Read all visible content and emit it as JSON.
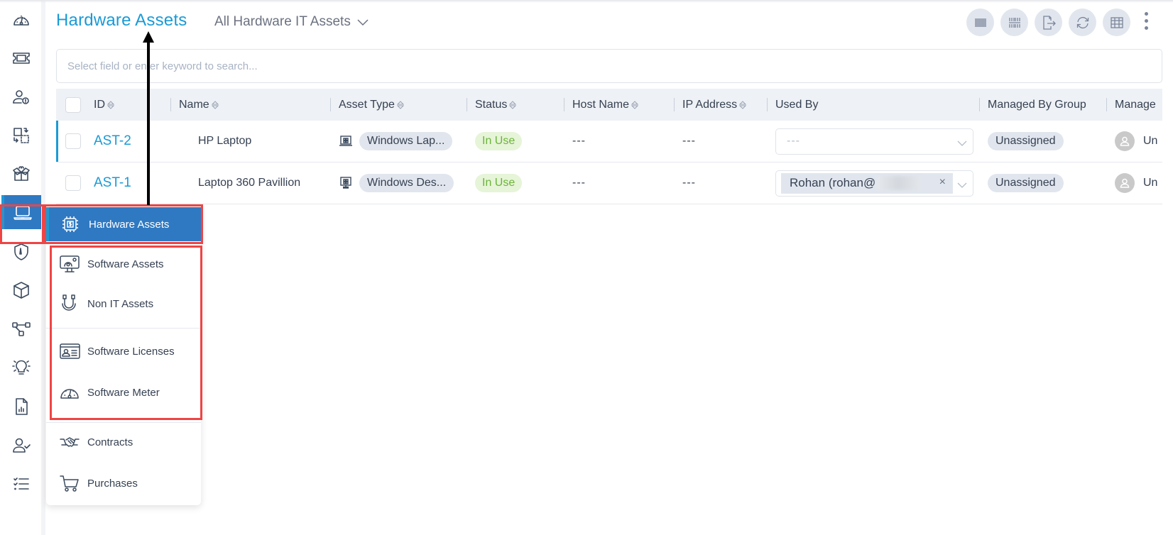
{
  "header": {
    "title": "Hardware Assets",
    "view_selector": "All Hardware IT Assets"
  },
  "toolbar": {
    "buttons": [
      {
        "icon": "barcode-icon",
        "label": "Barcode"
      },
      {
        "icon": "barcode-split-icon",
        "label": "Print Barcode"
      },
      {
        "icon": "export-icon",
        "label": "Export"
      },
      {
        "icon": "refresh-icon",
        "label": "Refresh"
      },
      {
        "icon": "table-columns-icon",
        "label": "Columns"
      }
    ],
    "more_icon": "more-vertical-icon"
  },
  "search": {
    "placeholder": "Select field or enter keyword to search..."
  },
  "table": {
    "columns": [
      "ID",
      "Name",
      "Asset Type",
      "Status",
      "Host Name",
      "IP Address",
      "Used By",
      "Managed By Group",
      "Manage"
    ],
    "rows": [
      {
        "id": "AST-2",
        "name": "HP Laptop",
        "asset_type_icon": "windows-laptop-icon",
        "asset_type": "Windows Lap...",
        "status": "In Use",
        "host_name": "---",
        "ip_address": "---",
        "used_by": "",
        "used_by_placeholder": "---",
        "managed_by_group": "Unassigned",
        "managed_by": "Un",
        "selected": true
      },
      {
        "id": "AST-1",
        "name": "Laptop 360 Pavillion",
        "asset_type_icon": "windows-desktop-icon",
        "asset_type": "Windows Des...",
        "status": "In Use",
        "host_name": "---",
        "ip_address": "---",
        "used_by": "Rohan (rohan@",
        "used_by_placeholder": "",
        "managed_by_group": "Unassigned",
        "managed_by": "Un",
        "selected": false
      }
    ]
  },
  "rail": {
    "items": [
      {
        "icon": "dashboard-gauge-icon"
      },
      {
        "icon": "ticket-icon"
      },
      {
        "icon": "user-alert-icon"
      },
      {
        "icon": "change-swap-icon"
      },
      {
        "icon": "release-box-icon"
      },
      {
        "icon": "laptop-icon",
        "active": true
      },
      {
        "icon": "shield-icon"
      },
      {
        "icon": "cube-icon"
      },
      {
        "icon": "workflow-icon"
      },
      {
        "icon": "bulb-icon"
      },
      {
        "icon": "report-icon"
      },
      {
        "icon": "user-check-icon"
      },
      {
        "icon": "task-list-icon"
      }
    ]
  },
  "asset_menu": {
    "active": "Hardware Assets",
    "items": [
      "Software Assets",
      "Non IT Assets",
      "Software Licenses",
      "Software Meter",
      "Contracts",
      "Purchases"
    ]
  },
  "colors": {
    "accent": "#1a9ad6",
    "active_bg": "#2f79c2",
    "status_in_use": "#6cb43a",
    "annotation": "#ef4444"
  }
}
